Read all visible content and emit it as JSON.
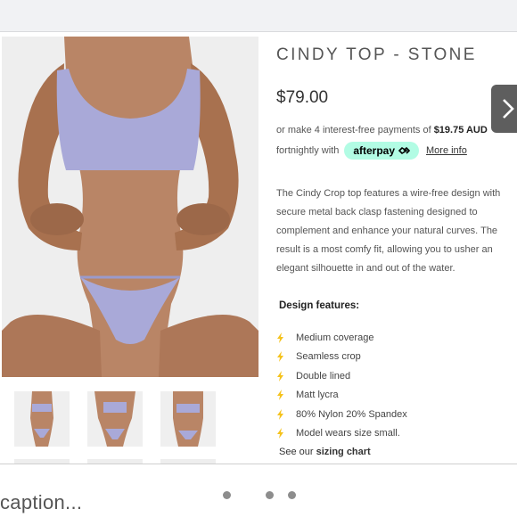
{
  "product": {
    "title": "CINDY TOP - STONE",
    "price": "$79.00",
    "installments_prefix": "or make 4 interest-free payments of ",
    "installments_amount": "$19.75 AUD",
    "fortnightly_text": "fortnightly with",
    "afterpay_label": "afterpay",
    "more_info_label": "More info",
    "description": "The Cindy Crop top features a wire-free design with secure metal back clasp fastening designed to complement and enhance your natural curves. The result is a most comfy fit, allowing you to usher an elegant silhouette in and out of the water.",
    "features_title": "Design features:",
    "features": [
      "Medium coverage",
      "Seamless crop",
      "Double lined",
      "Matt lycra",
      "80% Nylon 20% Spandex",
      "Model wears size small."
    ],
    "size_chart_prefix": "See our ",
    "size_chart_link": "sizing chart"
  },
  "caption": "caption...",
  "icons": {
    "feature_bullet": "lightning-bolt-icon",
    "next": "chevron-right-icon",
    "afterpay": "afterpay-loop-icon"
  },
  "colors": {
    "afterpay_mint": "#b2fce4",
    "bolt_yellow": "#f5c21c",
    "swimwear_lilac": "#a9a9d8",
    "arrow_bg": "#5e5e5e"
  },
  "carousel": {
    "dot_count": 3
  }
}
